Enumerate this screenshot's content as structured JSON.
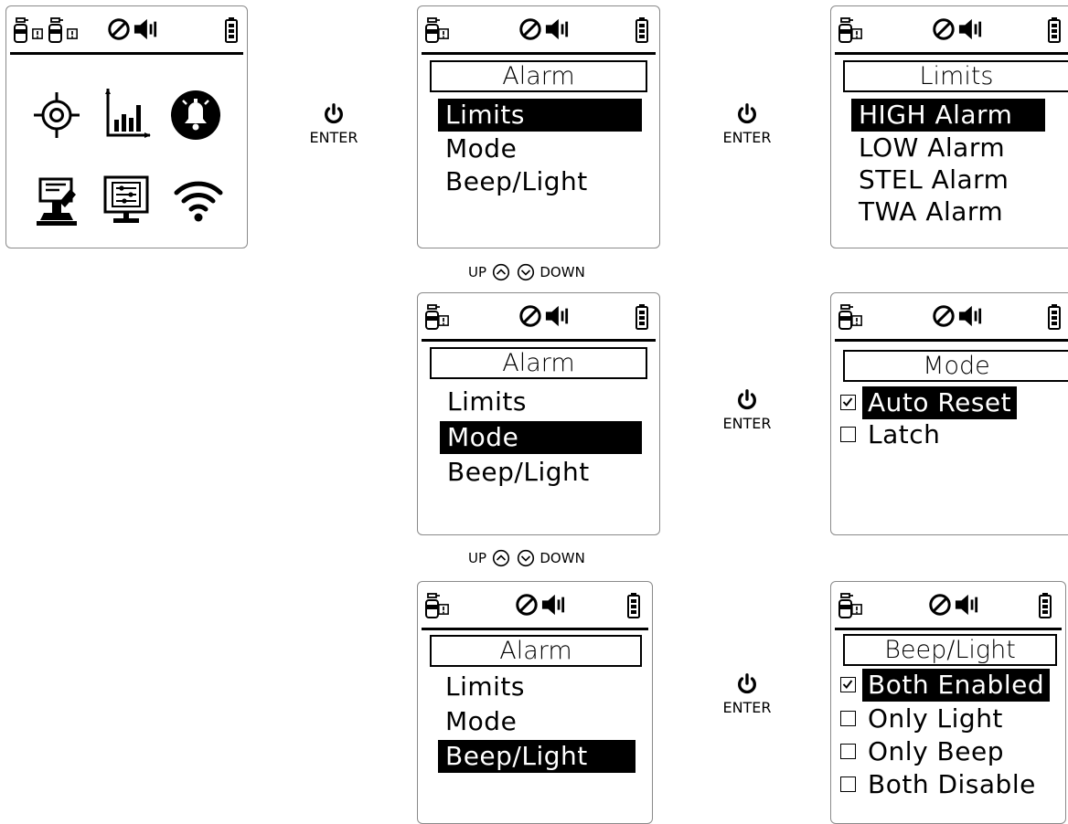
{
  "colors": {
    "foreground": "#000000",
    "background": "#ffffff",
    "frame": "#8a8a8a"
  },
  "icons": {
    "status_left": [
      "gas-sensor-icon",
      "alarm-sensor-icon"
    ],
    "status_center": [
      "no-vibrate-icon",
      "speaker-icon"
    ],
    "status_right": "battery-icon",
    "home_grid": [
      "target-crosshair-icon",
      "bar-chart-icon",
      "alarm-bell-icon",
      "settings-tools-icon",
      "monitor-sliders-icon",
      "wifi-icon"
    ],
    "enter": "power-icon",
    "nav": [
      "chevron-up-circle-icon",
      "chevron-down-circle-icon"
    ]
  },
  "alarm_menu": {
    "title": "Alarm",
    "items": [
      "Limits",
      "Mode",
      "Beep/Light"
    ]
  },
  "limits_menu": {
    "title": "Limits",
    "items": [
      "HIGH Alarm",
      "LOW Alarm",
      "STEL Alarm",
      "TWA Alarm"
    ],
    "selected": "HIGH Alarm"
  },
  "mode_menu": {
    "title": "Mode",
    "options": [
      {
        "label": "Auto Reset",
        "checked": true
      },
      {
        "label": "Latch",
        "checked": false
      }
    ]
  },
  "beep_menu": {
    "title": "Beep/Light",
    "options": [
      {
        "label": "Both Enabled",
        "checked": true
      },
      {
        "label": "Only Light",
        "checked": false
      },
      {
        "label": "Only Beep",
        "checked": false
      },
      {
        "label": "Both Disable",
        "checked": false
      }
    ]
  },
  "enter_label": "ENTER",
  "nav": {
    "up_label": "UP",
    "down_label": "DOWN"
  }
}
